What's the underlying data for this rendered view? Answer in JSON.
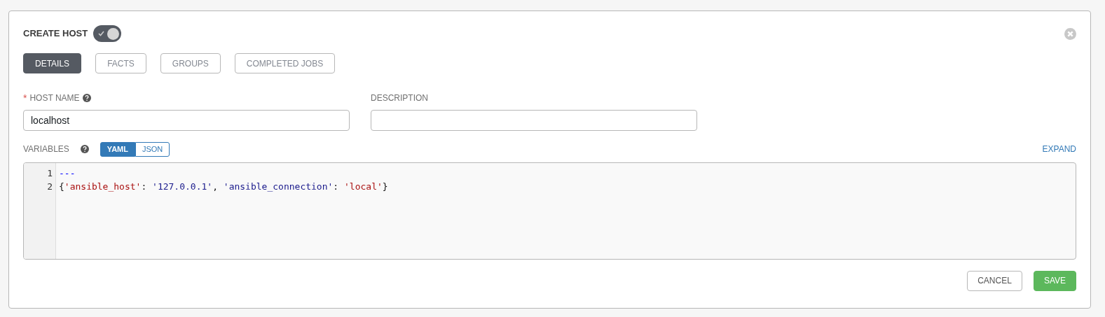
{
  "title": "CREATE HOST",
  "enabled_toggle": {
    "on": true
  },
  "tabs": [
    {
      "label": "DETAILS",
      "selected": true
    },
    {
      "label": "FACTS",
      "selected": false
    },
    {
      "label": "GROUPS",
      "selected": false
    },
    {
      "label": "COMPLETED JOBS",
      "selected": false
    }
  ],
  "fields": [
    {
      "label": "HOST NAME",
      "required": true,
      "required_marker": "*",
      "help": true,
      "value": "localhost"
    },
    {
      "label": "DESCRIPTION",
      "required": false,
      "help": false
    }
  ],
  "variables": {
    "label": "VARIABLES",
    "modes": [
      {
        "label": "YAML",
        "selected": true
      },
      {
        "label": "JSON",
        "selected": false
      }
    ],
    "expand": "EXPAND",
    "lines": [
      {
        "number": "1",
        "tokens": [
          {
            "kind": "meta",
            "text": "---"
          }
        ]
      },
      {
        "number": "2",
        "tokens": [
          {
            "kind": "plain",
            "text": "{"
          },
          {
            "kind": "string2",
            "text": "'ansible_host'"
          },
          {
            "kind": "plain",
            "text": ": "
          },
          {
            "kind": "string",
            "text": "'127.0.0.1'"
          },
          {
            "kind": "plain",
            "text": ", "
          },
          {
            "kind": "string",
            "text": "'ansible_connection'"
          },
          {
            "kind": "plain",
            "text": ": "
          },
          {
            "kind": "string2",
            "text": "'local'"
          },
          {
            "kind": "plain",
            "text": "}"
          }
        ]
      }
    ]
  },
  "buttons": [
    {
      "label": "CANCEL",
      "kind": "secondary"
    },
    {
      "label": "SAVE",
      "kind": "primary"
    }
  ]
}
